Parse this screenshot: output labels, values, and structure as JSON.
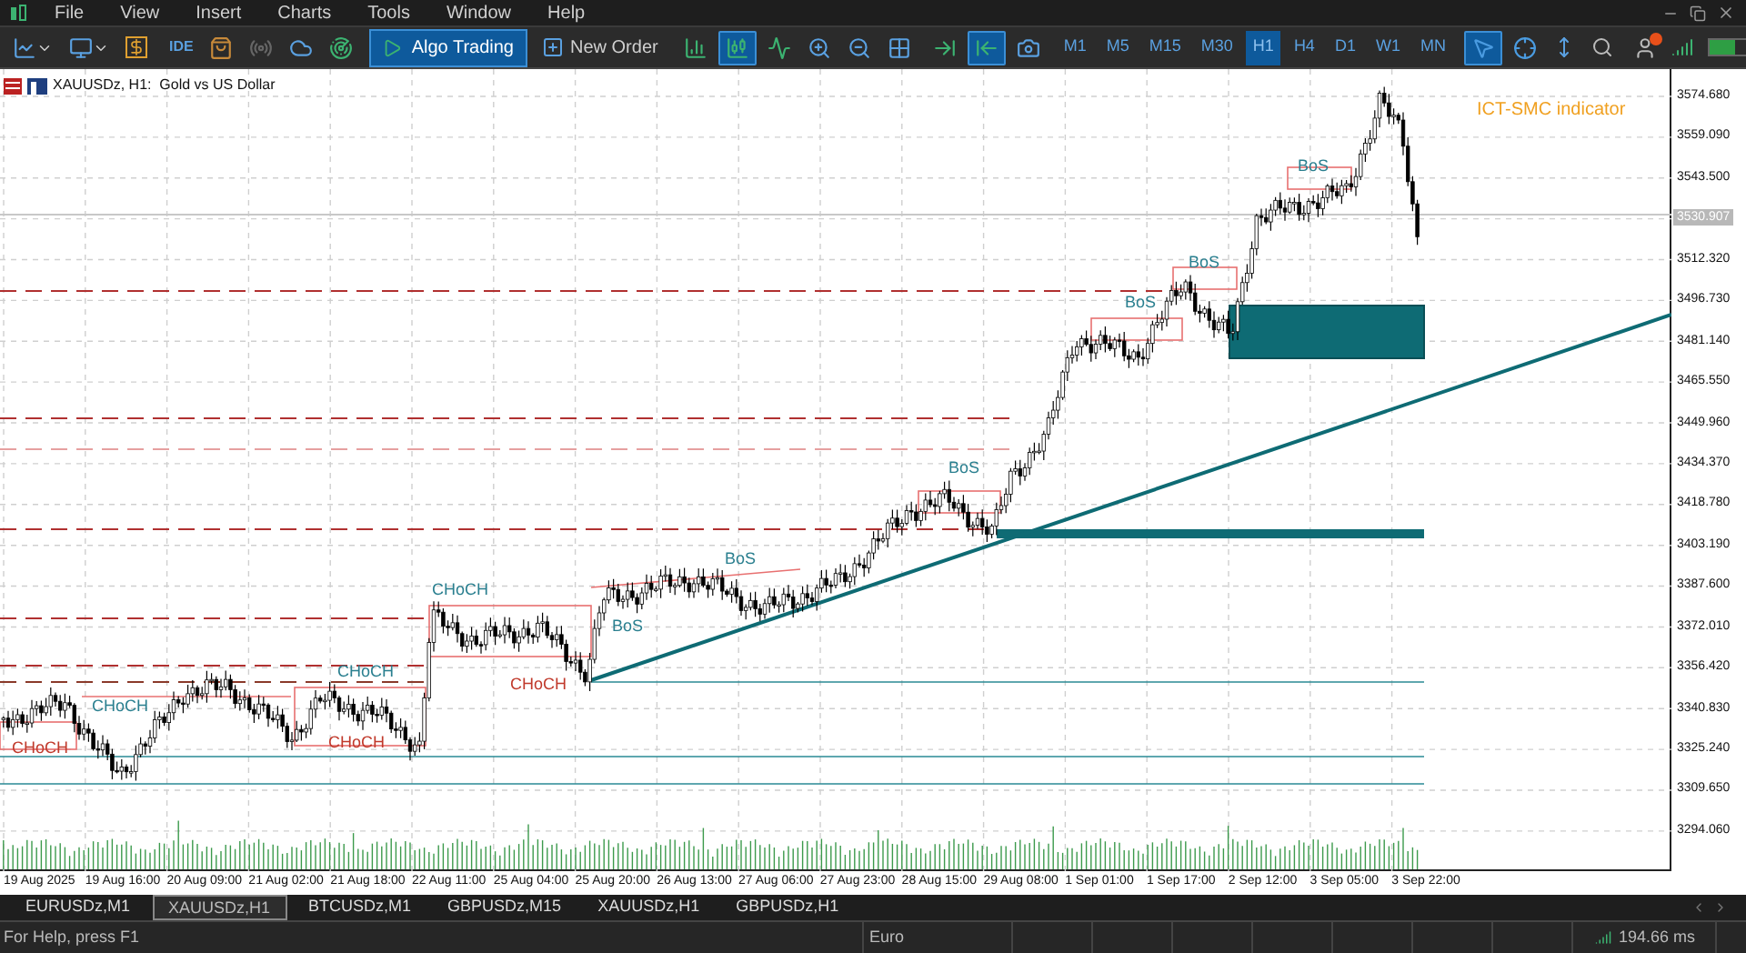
{
  "menu": [
    "File",
    "View",
    "Insert",
    "Charts",
    "Tools",
    "Window",
    "Help"
  ],
  "toolbar": {
    "ide_label": "IDE",
    "algo_trading": {
      "label": "Algo Trading",
      "on": true
    },
    "new_order": "New Order",
    "chart_types": [
      {
        "kind": "bars",
        "selected": false
      },
      {
        "kind": "candles",
        "selected": true
      },
      {
        "kind": "line",
        "selected": false
      }
    ],
    "scroll_tools": [
      {
        "kind": "shift",
        "selected": false
      },
      {
        "kind": "autoscroll",
        "selected": true
      }
    ],
    "timeframes": [
      {
        "label": "M1",
        "selected": false
      },
      {
        "label": "M5",
        "selected": false
      },
      {
        "label": "M15",
        "selected": false
      },
      {
        "label": "M30",
        "selected": false
      },
      {
        "label": "H1",
        "selected": true
      },
      {
        "label": "H4",
        "selected": false
      },
      {
        "label": "D1",
        "selected": false
      },
      {
        "label": "W1",
        "selected": false
      },
      {
        "label": "MN",
        "selected": false
      }
    ],
    "cursor_tools": [
      {
        "kind": "pointer",
        "selected": true
      },
      {
        "kind": "crosshair",
        "selected": false
      }
    ]
  },
  "chart": {
    "title": "XAUUSDz, H1:  Gold vs US Dollar",
    "indicator_label": "ICT-SMC indicator",
    "labels": [
      {
        "text": "CHoCH",
        "color": "#c0392b"
      },
      {
        "text": "CHoCH",
        "color": "#2a7f8f"
      },
      {
        "text": "CHoCH",
        "color": "#2a7f8f"
      },
      {
        "text": "CHoCH",
        "color": "#c0392b"
      },
      {
        "text": "CHoCH",
        "color": "#2a7f8f"
      },
      {
        "text": "CHoCH",
        "color": "#c0392b"
      },
      {
        "text": "BoS",
        "color": "#2a7f8f"
      },
      {
        "text": "BoS",
        "color": "#2a7f8f"
      },
      {
        "text": "BoS",
        "color": "#2a7f8f"
      },
      {
        "text": "BoS",
        "color": "#2a7f8f"
      },
      {
        "text": "BoS",
        "color": "#2a7f8f"
      },
      {
        "text": "BoS",
        "color": "#2a7f8f"
      }
    ],
    "price_ticks": [
      "3574.680",
      "3559.090",
      "3543.500",
      "3512.320",
      "3496.730",
      "3481.140",
      "3465.550",
      "3449.960",
      "3434.370",
      "3418.780",
      "3403.190",
      "3387.600",
      "3372.010",
      "3356.420",
      "3340.830",
      "3325.240",
      "3309.650",
      "3294.060"
    ],
    "current_price": "3530.907",
    "time_ticks": [
      "19 Aug 2025",
      "19 Aug 16:00",
      "20 Aug 09:00",
      "21 Aug 02:00",
      "21 Aug 18:00",
      "22 Aug 11:00",
      "25 Aug 04:00",
      "25 Aug 20:00",
      "26 Aug 13:00",
      "27 Aug 06:00",
      "27 Aug 23:00",
      "28 Aug 15:00",
      "29 Aug 08:00",
      "1 Sep 01:00",
      "1 Sep 17:00",
      "2 Sep 12:00",
      "3 Sep 05:00",
      "3 Sep 22:00"
    ]
  },
  "tabs": [
    {
      "label": "EURUSDz,M1",
      "selected": false
    },
    {
      "label": "XAUUSDz,H1",
      "selected": true
    },
    {
      "label": "BTCUSDz,M1",
      "selected": false
    },
    {
      "label": "GBPUSDz,M15",
      "selected": false
    },
    {
      "label": "XAUUSDz,H1",
      "selected": false
    },
    {
      "label": "GBPUSDz,H1",
      "selected": false
    }
  ],
  "status": {
    "help": "For Help, press F1",
    "section": "Euro",
    "ping": "194.66 ms"
  }
}
